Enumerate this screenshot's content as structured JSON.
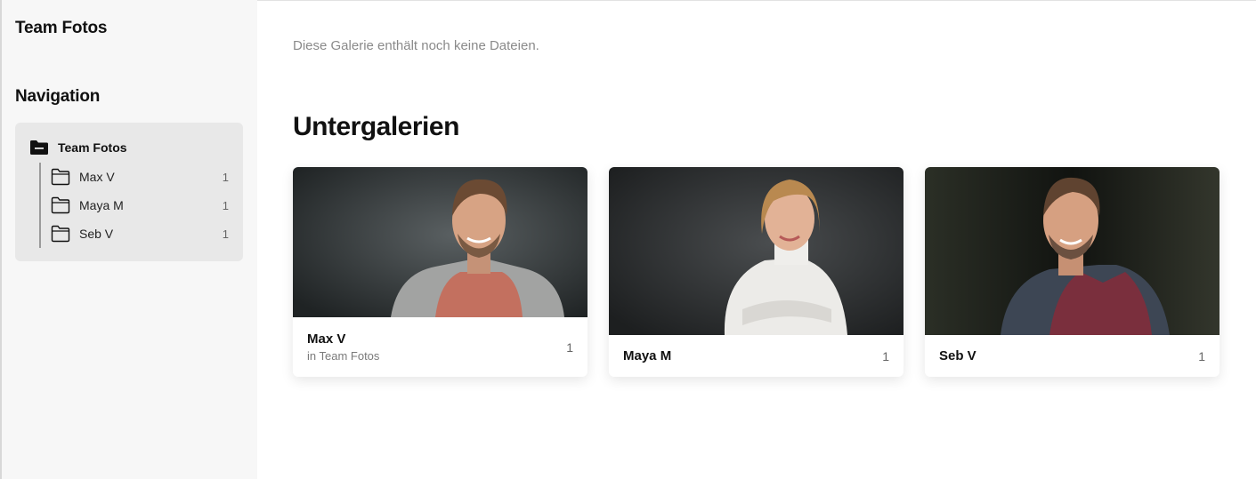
{
  "sidebar": {
    "title": "Team Fotos",
    "nav_heading": "Navigation",
    "tree": {
      "root": "Team Fotos",
      "items": [
        {
          "label": "Max V",
          "count": "1"
        },
        {
          "label": "Maya M",
          "count": "1"
        },
        {
          "label": "Seb V",
          "count": "1"
        }
      ]
    }
  },
  "main": {
    "empty_note": "Diese Galerie enthält noch keine Dateien.",
    "section_title": "Untergalerien",
    "cards": [
      {
        "name": "Max V",
        "subtitle": "in Team Fotos",
        "count": "1",
        "icon": "portrait-man-cardigan"
      },
      {
        "name": "Maya M",
        "count": "1",
        "icon": "portrait-woman-white-sweater"
      },
      {
        "name": "Seb V",
        "count": "1",
        "icon": "portrait-man-blazer"
      }
    ]
  },
  "colors": {
    "sidebar_bg": "#f7f7f7",
    "nav_box_bg": "#e8e8e8",
    "muted_text": "#8a8a8a"
  }
}
